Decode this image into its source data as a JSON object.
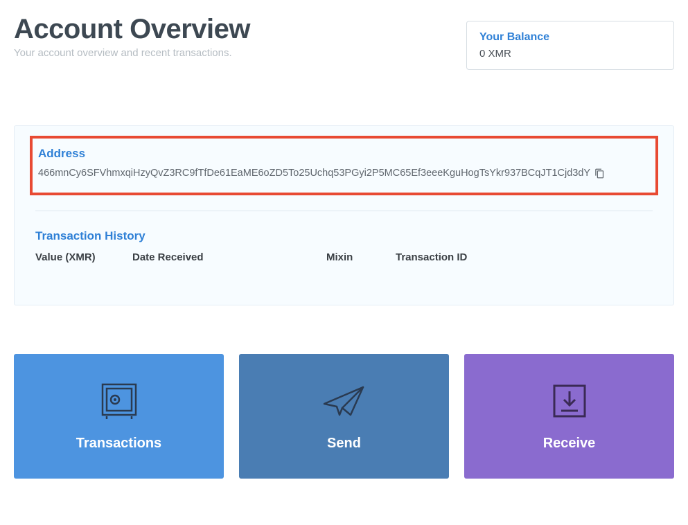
{
  "header": {
    "title": "Account Overview",
    "subtitle": "Your account overview and recent transactions."
  },
  "balance": {
    "label": "Your Balance",
    "value": "0 XMR"
  },
  "address": {
    "label": "Address",
    "value": "466mnCy6SFVhmxqiHzyQvZ3RC9fTfDe61EaME6oZD5To25Uchq53PGyi2P5MC65Ef3eeeKguHogTsYkr937BCqJT1Cjd3dY"
  },
  "tx_history": {
    "label": "Transaction History",
    "columns": {
      "value": "Value (XMR)",
      "date": "Date Received",
      "mixin": "Mixin",
      "txid": "Transaction ID"
    }
  },
  "actions": {
    "transactions": "Transactions",
    "send": "Send",
    "receive": "Receive"
  }
}
